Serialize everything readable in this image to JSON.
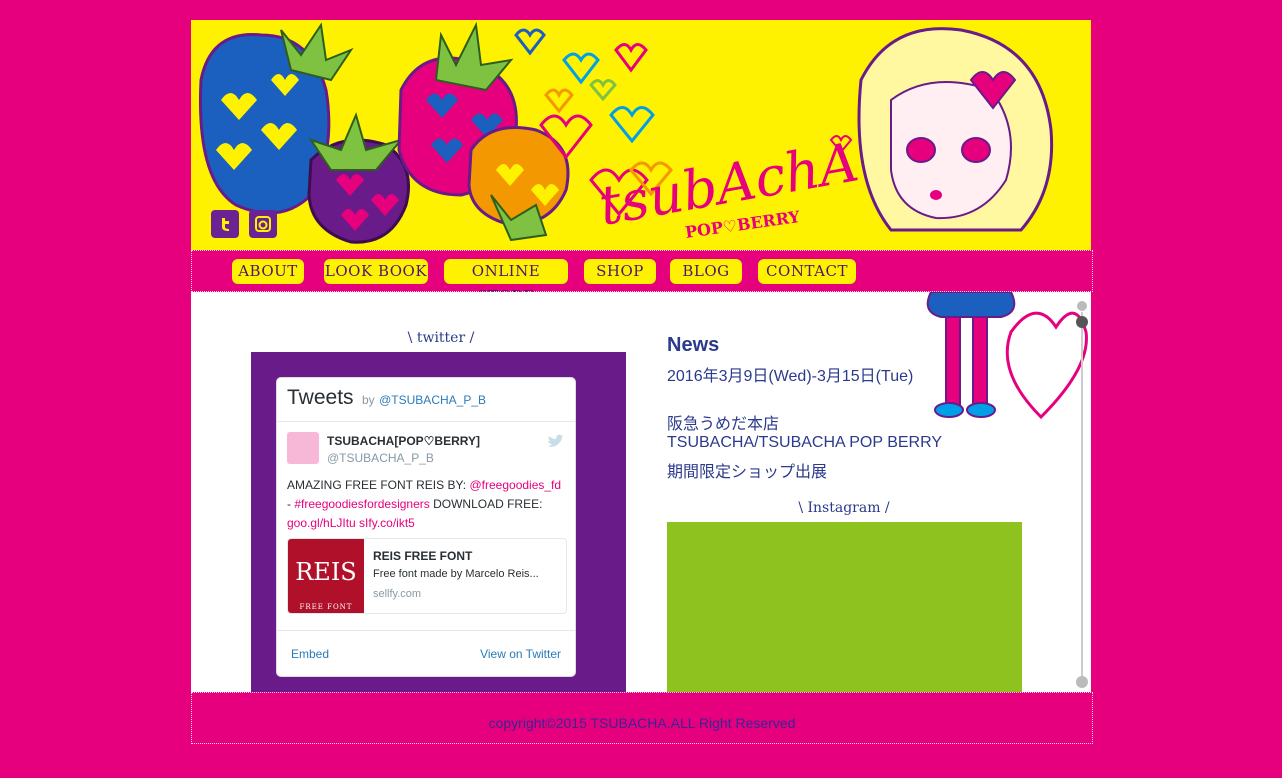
{
  "header": {
    "logo_text": "tsubAchA",
    "logo_sub": "POP♡BERRY",
    "social": [
      {
        "name": "twitter-icon",
        "glyph": "t"
      },
      {
        "name": "instagram-icon",
        "glyph": "◉"
      }
    ]
  },
  "nav": {
    "items": [
      {
        "label": "ABOUT"
      },
      {
        "label": "LOOK BOOK"
      },
      {
        "label": "ONLINE STORE"
      },
      {
        "label": "SHOP"
      },
      {
        "label": "BLOG"
      },
      {
        "label": "CONTACT"
      }
    ]
  },
  "twitter": {
    "section_label": "\\ twitter /",
    "widget_title": "Tweets",
    "by": "by",
    "handle": "@TSUBACHA_P_B",
    "tweet": {
      "name": "TSUBACHA[POP♡BERRY]",
      "user": "@TSUBACHA_P_B",
      "text_1": "AMAZING FREE FONT REIS BY: ",
      "link_1": "@freegoodies_fd",
      "text_2": "- ",
      "link_2": "#freegoodiesfordesigners",
      "text_3": " DOWNLOAD FREE: ",
      "link_3": "goo.gl/hLJItu sIfy.co/ikt5",
      "card": {
        "thumb": "REIS",
        "thumb_sub": "FREE FONT",
        "title": "REIS FREE FONT",
        "desc": "Free font made by Marcelo Reis...",
        "url": "sellfy.com"
      }
    },
    "embed": "Embed",
    "view": "View on Twitter"
  },
  "news": {
    "title": "News",
    "lines": [
      "2016年3月9日(Wed)-3月15日(Tue)",
      "阪急うめだ本店",
      "TSUBACHA/TSUBACHA POP BERRY",
      "期間限定ショップ出展"
    ]
  },
  "instagram": {
    "section_label": "\\ Instagram /",
    "color": "#8dc21f"
  },
  "footer": {
    "copyright": "copyright©2015 TSUBACHA.ALL Right Reserved"
  },
  "colors": {
    "background": "#e6007e",
    "header": "#fff200",
    "twitter_box": "#6a1b8a",
    "text": "#2b3a8c"
  }
}
